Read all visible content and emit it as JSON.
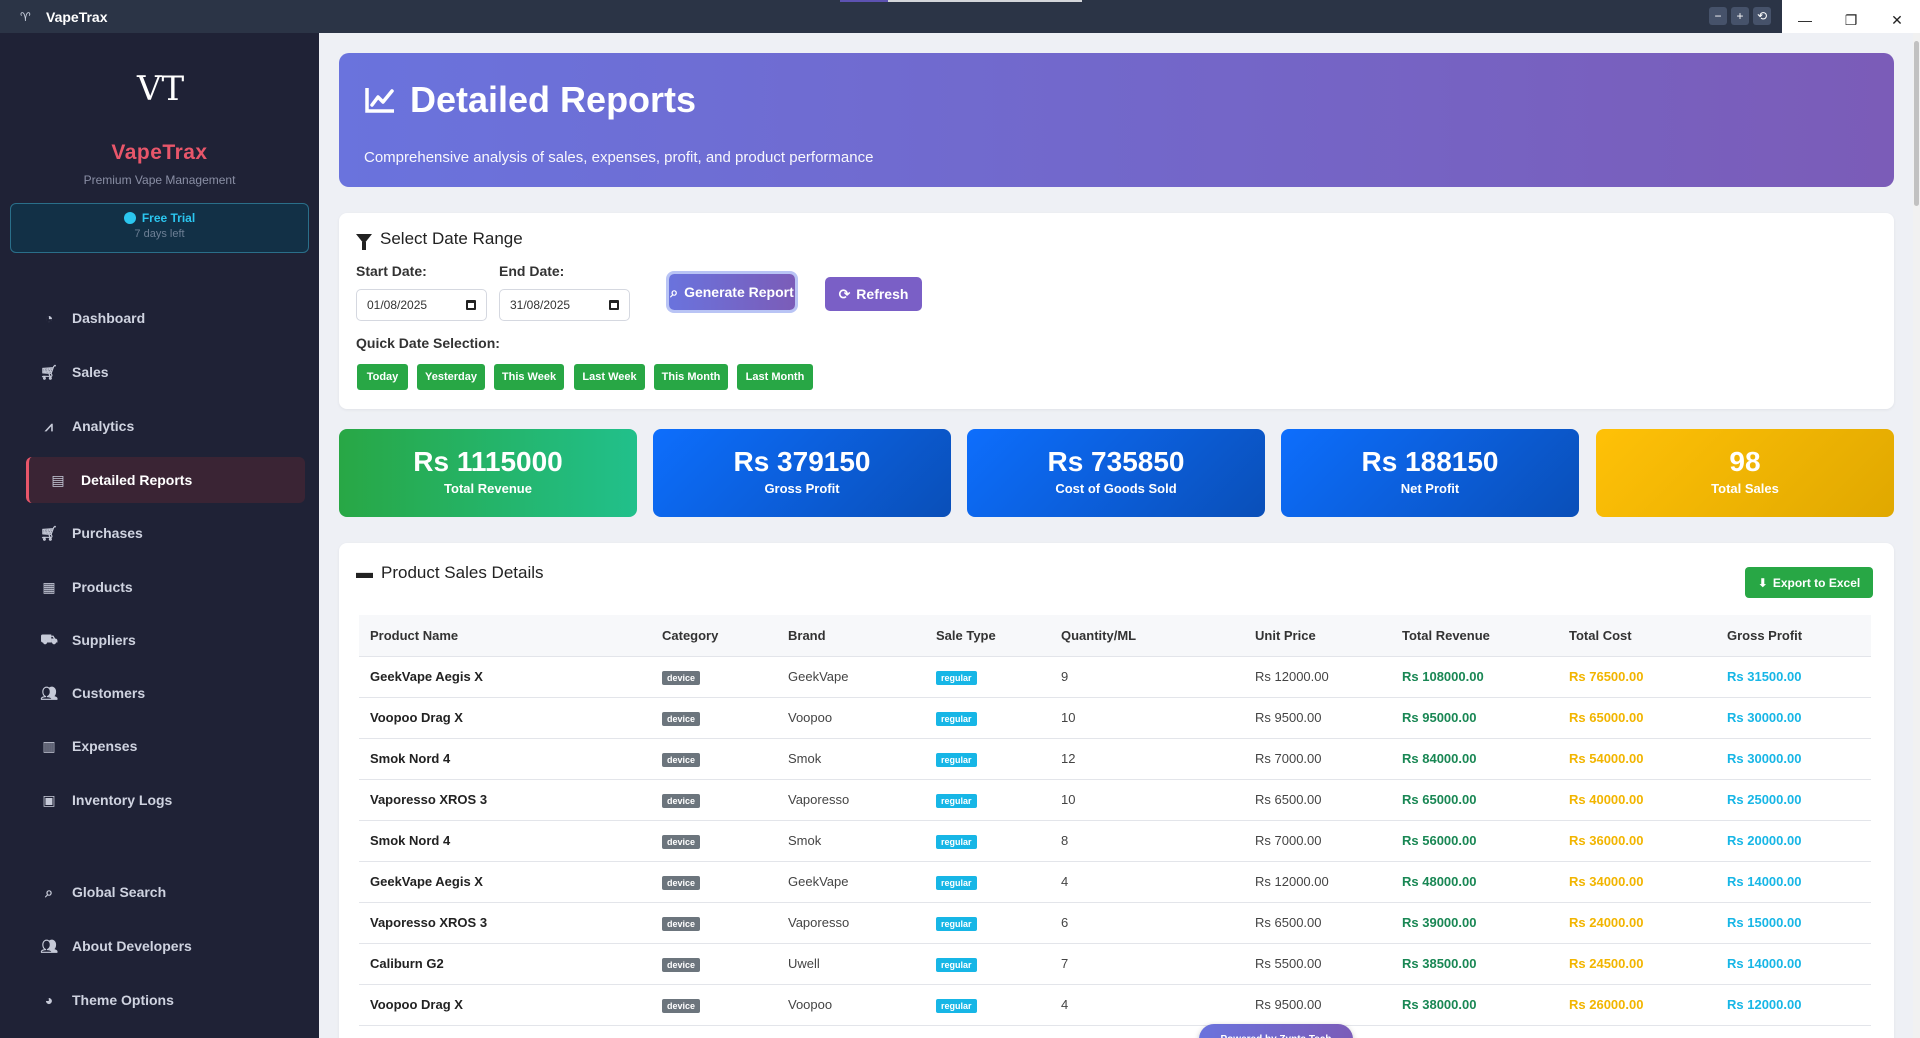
{
  "window": {
    "title": "VapeTrax"
  },
  "sidebar": {
    "brand": "VapeTrax",
    "subtitle": "Premium Vape Management",
    "trial": {
      "label": "Free Trial",
      "remaining": "7 days left"
    },
    "items": [
      {
        "label": "Dashboard",
        "icon": "dashboard-icon"
      },
      {
        "label": "Sales",
        "icon": "cart-icon"
      },
      {
        "label": "Analytics",
        "icon": "chart-line-icon"
      },
      {
        "label": "Detailed Reports",
        "icon": "file-icon",
        "active": true
      },
      {
        "label": "Purchases",
        "icon": "cart-icon"
      },
      {
        "label": "Products",
        "icon": "boxes-icon"
      },
      {
        "label": "Suppliers",
        "icon": "truck-icon"
      },
      {
        "label": "Customers",
        "icon": "users-icon"
      },
      {
        "label": "Expenses",
        "icon": "receipt-icon"
      },
      {
        "label": "Inventory Logs",
        "icon": "clipboard-icon"
      }
    ],
    "bottom_items": [
      {
        "label": "Global Search",
        "icon": "search-icon"
      },
      {
        "label": "About Developers",
        "icon": "users-icon"
      },
      {
        "label": "Theme Options",
        "icon": "palette-icon"
      }
    ]
  },
  "header": {
    "title": "Detailed Reports",
    "subtitle": "Comprehensive analysis of sales, expenses, profit, and product performance"
  },
  "date_range": {
    "title": "Select Date Range",
    "start_label": "Start Date:",
    "start_value": "01/08/2025",
    "end_label": "End Date:",
    "end_value": "31/08/2025",
    "generate_label": "Generate Report",
    "refresh_label": "Refresh",
    "quick_label": "Quick Date Selection:",
    "quick": [
      "Today",
      "Yesterday",
      "This Week",
      "Last Week",
      "This Month",
      "Last Month"
    ]
  },
  "stats": [
    {
      "value": "Rs 1115000",
      "label": "Total Revenue",
      "color": "#28a745"
    },
    {
      "value": "Rs 379150",
      "label": "Gross Profit",
      "color": "#0b63d6"
    },
    {
      "value": "Rs 735850",
      "label": "Cost of Goods Sold",
      "color": "#0b63d6"
    },
    {
      "value": "Rs 188150",
      "label": "Net Profit",
      "color": "#0b63d6"
    },
    {
      "value": "98",
      "label": "Total Sales",
      "color": "#f5b800"
    }
  ],
  "sales": {
    "title": "Product Sales Details",
    "export_label": "Export to Excel",
    "columns": [
      "Product Name",
      "Category",
      "Brand",
      "Sale Type",
      "Quantity/ML",
      "Unit Price",
      "Total Revenue",
      "Total Cost",
      "Gross Profit"
    ],
    "rows": [
      [
        "GeekVape Aegis X",
        "device",
        "GeekVape",
        "regular",
        "9",
        "Rs 12000.00",
        "Rs 108000.00",
        "Rs 76500.00",
        "Rs 31500.00"
      ],
      [
        "Voopoo Drag X",
        "device",
        "Voopoo",
        "regular",
        "10",
        "Rs 9500.00",
        "Rs 95000.00",
        "Rs 65000.00",
        "Rs 30000.00"
      ],
      [
        "Smok Nord 4",
        "device",
        "Smok",
        "regular",
        "12",
        "Rs 7000.00",
        "Rs 84000.00",
        "Rs 54000.00",
        "Rs 30000.00"
      ],
      [
        "Vaporesso XROS 3",
        "device",
        "Vaporesso",
        "regular",
        "10",
        "Rs 6500.00",
        "Rs 65000.00",
        "Rs 40000.00",
        "Rs 25000.00"
      ],
      [
        "Smok Nord 4",
        "device",
        "Smok",
        "regular",
        "8",
        "Rs 7000.00",
        "Rs 56000.00",
        "Rs 36000.00",
        "Rs 20000.00"
      ],
      [
        "GeekVape Aegis X",
        "device",
        "GeekVape",
        "regular",
        "4",
        "Rs 12000.00",
        "Rs 48000.00",
        "Rs 34000.00",
        "Rs 14000.00"
      ],
      [
        "Vaporesso XROS 3",
        "device",
        "Vaporesso",
        "regular",
        "6",
        "Rs 6500.00",
        "Rs 39000.00",
        "Rs 24000.00",
        "Rs 15000.00"
      ],
      [
        "Caliburn G2",
        "device",
        "Uwell",
        "regular",
        "7",
        "Rs 5500.00",
        "Rs 38500.00",
        "Rs 24500.00",
        "Rs 14000.00"
      ],
      [
        "Voopoo Drag X",
        "device",
        "Voopoo",
        "regular",
        "4",
        "Rs 9500.00",
        "Rs 38000.00",
        "Rs 26000.00",
        "Rs 12000.00"
      ]
    ]
  },
  "footer": {
    "powered": "Powered by Zynta Tech"
  }
}
